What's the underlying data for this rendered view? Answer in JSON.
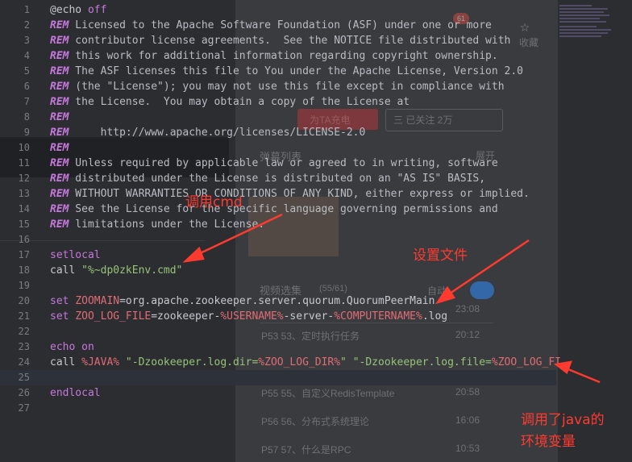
{
  "editor": {
    "lines": [
      {
        "n": "1",
        "parts": [
          {
            "t": "@echo ",
            "c": "plain"
          },
          {
            "t": "off",
            "c": "kw"
          }
        ]
      },
      {
        "n": "2",
        "parts": [
          {
            "t": "REM",
            "c": "rem"
          },
          {
            "t": " Licensed to the Apache Software Foundation (ASF) under one or more",
            "c": "comment"
          }
        ]
      },
      {
        "n": "3",
        "parts": [
          {
            "t": "REM",
            "c": "rem"
          },
          {
            "t": " contributor license agreements.  See the NOTICE file distributed with",
            "c": "comment"
          }
        ]
      },
      {
        "n": "4",
        "parts": [
          {
            "t": "REM",
            "c": "rem"
          },
          {
            "t": " this work for additional information regarding copyright ownership.",
            "c": "comment"
          }
        ]
      },
      {
        "n": "5",
        "parts": [
          {
            "t": "REM",
            "c": "rem"
          },
          {
            "t": " The ASF licenses this file to You under the Apache License, Version 2.0",
            "c": "comment"
          }
        ]
      },
      {
        "n": "6",
        "parts": [
          {
            "t": "REM",
            "c": "rem"
          },
          {
            "t": " (the \"License\"); you may not use this file except in compliance with",
            "c": "comment"
          }
        ]
      },
      {
        "n": "7",
        "parts": [
          {
            "t": "REM",
            "c": "rem"
          },
          {
            "t": " the License.  You may obtain a copy of the License at",
            "c": "comment"
          }
        ]
      },
      {
        "n": "8",
        "parts": [
          {
            "t": "REM",
            "c": "rem"
          }
        ]
      },
      {
        "n": "9",
        "parts": [
          {
            "t": "REM",
            "c": "rem"
          },
          {
            "t": "     http://www.apache.org/licenses/LICENSE-2.0",
            "c": "comment"
          }
        ]
      },
      {
        "n": "10",
        "parts": [
          {
            "t": "REM",
            "c": "rem"
          }
        ]
      },
      {
        "n": "11",
        "parts": [
          {
            "t": "REM",
            "c": "rem"
          },
          {
            "t": " Unless required by applicable law or agreed to in writing, software",
            "c": "comment"
          }
        ]
      },
      {
        "n": "12",
        "parts": [
          {
            "t": "REM",
            "c": "rem"
          },
          {
            "t": " distributed under the License is distributed on an \"AS IS\" BASIS,",
            "c": "comment"
          }
        ]
      },
      {
        "n": "13",
        "parts": [
          {
            "t": "REM",
            "c": "rem"
          },
          {
            "t": " WITHOUT WARRANTIES OR CONDITIONS OF ANY KIND, either express or implied.",
            "c": "comment"
          }
        ]
      },
      {
        "n": "14",
        "parts": [
          {
            "t": "REM",
            "c": "rem"
          },
          {
            "t": " See the License for the specific language governing permissions and",
            "c": "comment"
          }
        ]
      },
      {
        "n": "15",
        "parts": [
          {
            "t": "REM",
            "c": "rem"
          },
          {
            "t": " limitations under the License.",
            "c": "comment"
          }
        ]
      },
      {
        "n": "16",
        "parts": []
      },
      {
        "n": "17",
        "parts": [
          {
            "t": "setlocal",
            "c": "kw"
          }
        ]
      },
      {
        "n": "18",
        "parts": [
          {
            "t": "call ",
            "c": "plain"
          },
          {
            "t": "\"%~dp0",
            "c": "str"
          },
          {
            "t": "zkEnv.cmd\"",
            "c": "str"
          }
        ]
      },
      {
        "n": "19",
        "parts": []
      },
      {
        "n": "20",
        "parts": [
          {
            "t": "set ",
            "c": "kw"
          },
          {
            "t": "ZOOMAIN",
            "c": "var"
          },
          {
            "t": "=org.apache.zookeeper.server.quorum.QuorumPeerMain",
            "c": "plain"
          }
        ]
      },
      {
        "n": "21",
        "parts": [
          {
            "t": "set ",
            "c": "kw"
          },
          {
            "t": "ZOO_LOG_FILE",
            "c": "var"
          },
          {
            "t": "=zookeeper-",
            "c": "plain"
          },
          {
            "t": "%USERNAME%",
            "c": "var"
          },
          {
            "t": "-server-",
            "c": "plain"
          },
          {
            "t": "%COMPUTERNAME%",
            "c": "var"
          },
          {
            "t": ".log",
            "c": "plain"
          }
        ]
      },
      {
        "n": "22",
        "parts": []
      },
      {
        "n": "23",
        "parts": [
          {
            "t": "echo ",
            "c": "kw"
          },
          {
            "t": "on",
            "c": "kw"
          }
        ]
      },
      {
        "n": "24",
        "parts": [
          {
            "t": "call ",
            "c": "plain"
          },
          {
            "t": "%JAVA%",
            "c": "var"
          },
          {
            "t": " \"-Dzookeeper.log.dir=",
            "c": "str"
          },
          {
            "t": "%ZOO_LOG_DIR%",
            "c": "var"
          },
          {
            "t": "\"",
            "c": "str"
          },
          {
            "t": " \"-Dzookeeper.log.file=",
            "c": "str"
          },
          {
            "t": "%ZOO_LOG_FI",
            "c": "var"
          }
        ]
      },
      {
        "n": "25",
        "parts": [],
        "active": true
      },
      {
        "n": "26",
        "parts": [
          {
            "t": "endlocal",
            "c": "kw"
          }
        ]
      },
      {
        "n": "27",
        "parts": []
      }
    ]
  },
  "annotations": {
    "call_cmd": "调用cmd",
    "set_file": "设置文件",
    "java_env_line1": "调用了java的",
    "java_env_line2": "环境变量"
  },
  "background_page": {
    "danmaku_list": "弹幕列表",
    "expand": "展开",
    "charge_button": "为TA充电",
    "follow_button": "三 已关注 2万",
    "video_selection": "视频选集",
    "episode_count": "(55/61)",
    "autoplay": "自动",
    "collect": "收藏",
    "badge_count": "61",
    "episodes": [
      {
        "title": "P53  53、定时执行任务",
        "duration": "20:12"
      },
      {
        "title": "P55  55、自定义RedisTemplate",
        "duration": "20:58"
      },
      {
        "title": "P56  56、分布式系统理论",
        "duration": "16:06"
      },
      {
        "title": "P57  57、什么是RPC",
        "duration": "10:53"
      }
    ],
    "first_duration": "23:08"
  },
  "colors": {
    "annotation_red": "#ff3b30",
    "keyword_purple": "#c678dd",
    "string_green": "#98c379",
    "variable_red": "#e06c75"
  }
}
